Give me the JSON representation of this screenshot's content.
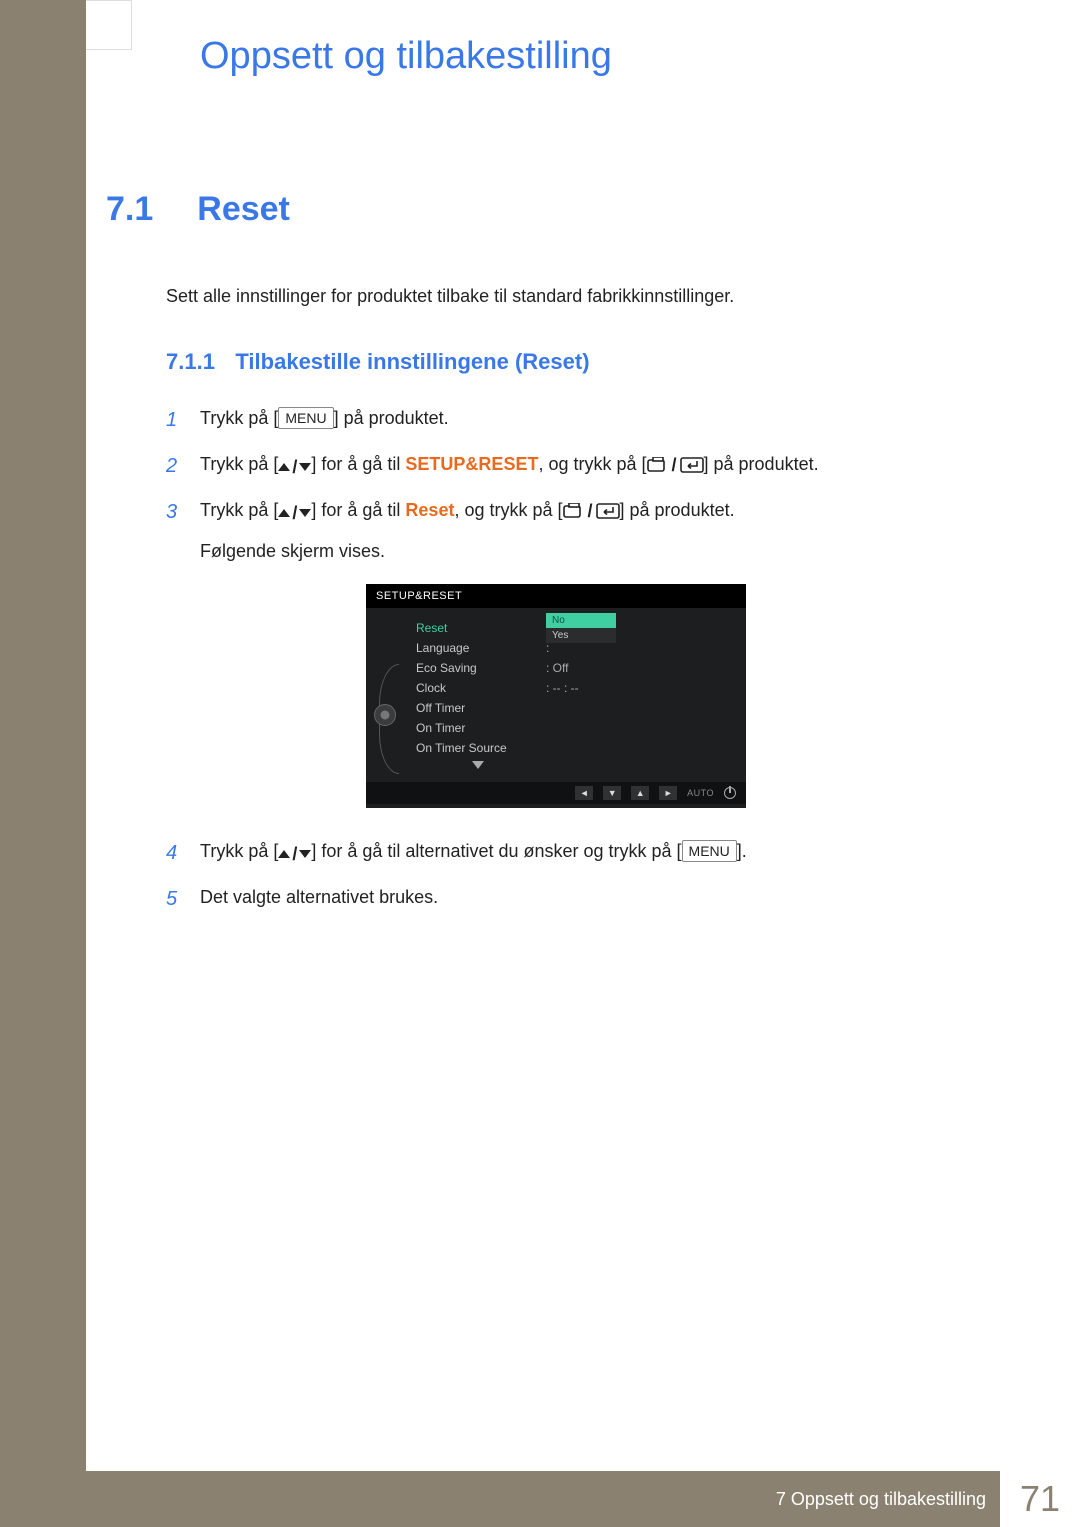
{
  "chapter_title": "Oppsett og tilbakestilling",
  "section": {
    "num": "7.1",
    "title": "Reset"
  },
  "intro": "Sett alle innstillinger for produktet tilbake til standard fabrikkinnstillinger.",
  "subsection": {
    "num": "7.1.1",
    "title": "Tilbakestille innstillingene (Reset)"
  },
  "menu_key": "MENU",
  "steps": {
    "s1": {
      "num": "1",
      "a": "Trykk på [",
      "b": "] på produktet."
    },
    "s2": {
      "num": "2",
      "a": "Trykk på [",
      "b": "] for å gå til ",
      "target": "SETUP&RESET",
      "c": ", og trykk på [",
      "d": "] på produktet."
    },
    "s3": {
      "num": "3",
      "a": "Trykk på [",
      "b": "] for å gå til ",
      "target": "Reset",
      "c": ", og trykk på [",
      "d": "] på produktet."
    },
    "s4": {
      "num": "4",
      "a": "Trykk på [",
      "b": "] for å gå til alternativet du ønsker og trykk på [",
      "c": "]."
    },
    "s5": {
      "num": "5",
      "text": "Det valgte alternativet brukes."
    }
  },
  "following": "Følgende skjerm vises.",
  "osd": {
    "header": "SETUP&RESET",
    "items": [
      {
        "label": "Reset",
        "selected": true
      },
      {
        "label": "Language",
        "value": ":"
      },
      {
        "label": "Eco Saving",
        "value": ": Off"
      },
      {
        "label": "Clock",
        "value": ":   -- : --"
      },
      {
        "label": "Off Timer",
        "value": ""
      },
      {
        "label": "On Timer",
        "value": ""
      },
      {
        "label": "On Timer Source",
        "value": ""
      }
    ],
    "popup": {
      "header": "No",
      "item": "Yes"
    },
    "footer_auto": "AUTO"
  },
  "footer": {
    "label": "7 Oppsett og tilbakestilling",
    "page": "71"
  }
}
